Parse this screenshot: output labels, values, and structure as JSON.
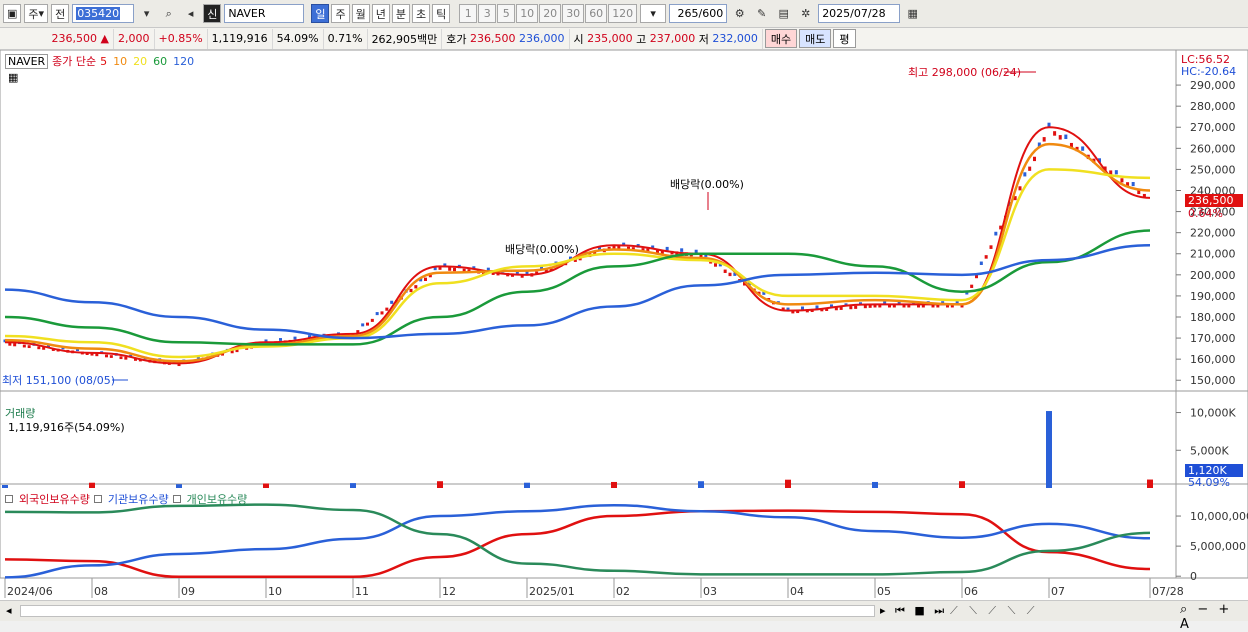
{
  "toolbar": {
    "type": "주",
    "prev_label": "전",
    "code": "035420",
    "market_badge": "신",
    "stock_name": "NAVER",
    "periods": [
      "일",
      "주",
      "월",
      "년",
      "분",
      "초",
      "틱"
    ],
    "active_period": "일",
    "numbers": [
      "1",
      "3",
      "5",
      "10",
      "20",
      "30",
      "60",
      "120"
    ],
    "count": "265",
    "max_count": "/600",
    "date": "2025/07/28"
  },
  "quote": {
    "price": "236,500",
    "change_arrow": "▲",
    "change": "2,000",
    "change_pct": "+0.85%",
    "volume": "1,119,916",
    "vol_ratio": "54.09%",
    "turnover": "0.71%",
    "amount": "262,905백만",
    "ask_label": "호가",
    "ask1": "236,500",
    "ask2": "236,000",
    "open_label": "시",
    "open": "235,000",
    "high_label": "고",
    "high": "237,000",
    "low_label": "저",
    "low": "232,000",
    "buy": "매수",
    "sell": "매도",
    "eval": "평"
  },
  "price_legend": {
    "name": "NAVER",
    "type": "종가 단순",
    "ma": [
      {
        "label": "5",
        "color": "#e01010"
      },
      {
        "label": "10",
        "color": "#f08a10"
      },
      {
        "label": "20",
        "color": "#f0e020"
      },
      {
        "label": "60",
        "color": "#1a9a3a"
      },
      {
        "label": "120",
        "color": "#2a60d8"
      }
    ],
    "lc": "LC:56.52",
    "hc": "HC:-20.64"
  },
  "volume_legend": {
    "title": "거래량",
    "value": "1,119,916주(54.09%)"
  },
  "holder_legend": [
    "외국인보유수량",
    "기관보유수량",
    "개인보유수량"
  ],
  "annotations": {
    "high": "최고 298,000 (06/24)",
    "low": "최저 151,100 (08/05)",
    "div1": "배당락(0.00%)",
    "div2": "배당락(0.00%)"
  },
  "current_price_box": "236,500",
  "current_pct_box": "0.64%",
  "volume_box": "1,120K",
  "volume_pct_box": "54.09%",
  "x_axis_labels": [
    "2024/06",
    "08",
    "09",
    "10",
    "11",
    "12",
    "2025/01",
    "02",
    "03",
    "04",
    "05",
    "06",
    "07",
    "07/28"
  ],
  "chart_data": [
    {
      "type": "line",
      "title": "NAVER",
      "y_ticks": [
        "290,000",
        "280,000",
        "270,000",
        "260,000",
        "250,000",
        "240,000",
        "230,000",
        "220,000",
        "210,000",
        "200,000",
        "190,000",
        "180,000",
        "170,000",
        "160,000",
        "150,000"
      ],
      "ylim": [
        143000,
        300000
      ],
      "x": [
        "2024/06",
        "08",
        "09",
        "10",
        "11",
        "12",
        "2025/01",
        "02",
        "03",
        "04",
        "05",
        "06",
        "07",
        "07/28"
      ],
      "series": [
        {
          "name": "5",
          "color": "#e01010",
          "values": [
            168000,
            163000,
            158000,
            168000,
            172000,
            204000,
            200000,
            214000,
            210000,
            183000,
            186000,
            186000,
            270000,
            236500
          ]
        },
        {
          "name": "10",
          "color": "#f08a10",
          "values": [
            169000,
            165000,
            159000,
            167000,
            171000,
            201000,
            202000,
            212000,
            208000,
            186000,
            188000,
            186000,
            262000,
            240000
          ]
        },
        {
          "name": "20",
          "color": "#f0e020",
          "values": [
            171000,
            168000,
            161000,
            166000,
            170000,
            196000,
            204000,
            210000,
            207000,
            190000,
            190000,
            188000,
            250000,
            246000
          ]
        },
        {
          "name": "60",
          "color": "#1a9a3a",
          "values": [
            180000,
            175000,
            168000,
            167000,
            167000,
            180000,
            192000,
            204000,
            210000,
            210000,
            204000,
            192000,
            206000,
            221000
          ]
        },
        {
          "name": "120",
          "color": "#2a60d8",
          "values": [
            193000,
            187000,
            180000,
            174000,
            170000,
            172000,
            176000,
            185000,
            195000,
            200000,
            201000,
            200000,
            207000,
            214000
          ]
        }
      ]
    },
    {
      "type": "bar",
      "title": "거래량",
      "y_ticks": [
        "10,000K",
        "5,000K"
      ],
      "ylim": [
        0,
        11000
      ],
      "x": [
        "2024/06",
        "08",
        "09",
        "10",
        "11",
        "12",
        "2025/01",
        "02",
        "03",
        "04",
        "05",
        "06",
        "07",
        "07/28"
      ],
      "values": [
        400,
        700,
        500,
        600,
        650,
        900,
        700,
        800,
        900,
        1100,
        800,
        900,
        10200,
        1120
      ]
    },
    {
      "type": "line",
      "title": "보유수량",
      "y_ticks": [
        "10,000,000",
        "5,000,000",
        "0"
      ],
      "ylim": [
        -300000,
        13000000
      ],
      "x": [
        "2024/06",
        "08",
        "09",
        "10",
        "11",
        "12",
        "2025/01",
        "02",
        "03",
        "04",
        "05",
        "06",
        "07",
        "07/28"
      ],
      "series": [
        {
          "name": "외국인보유수량",
          "color": "#e01010",
          "values": [
            2800000,
            2500000,
            -100000,
            -100000,
            -100000,
            3200000,
            7000000,
            10000000,
            10800000,
            10900000,
            10700000,
            10300000,
            4000000,
            1200000
          ]
        },
        {
          "name": "기관보유수량",
          "color": "#2a60d8",
          "values": [
            -200000,
            1800000,
            3700000,
            4500000,
            6200000,
            10000000,
            10800000,
            11800000,
            10800000,
            9800000,
            7500000,
            6400000,
            8700000,
            6300000
          ]
        },
        {
          "name": "개인보유수량",
          "color": "#2a8a5a",
          "values": [
            10700000,
            10600000,
            11700000,
            11900000,
            11000000,
            7000000,
            2100000,
            900000,
            300000,
            300000,
            300000,
            700000,
            4200000,
            7200000
          ]
        }
      ]
    }
  ]
}
